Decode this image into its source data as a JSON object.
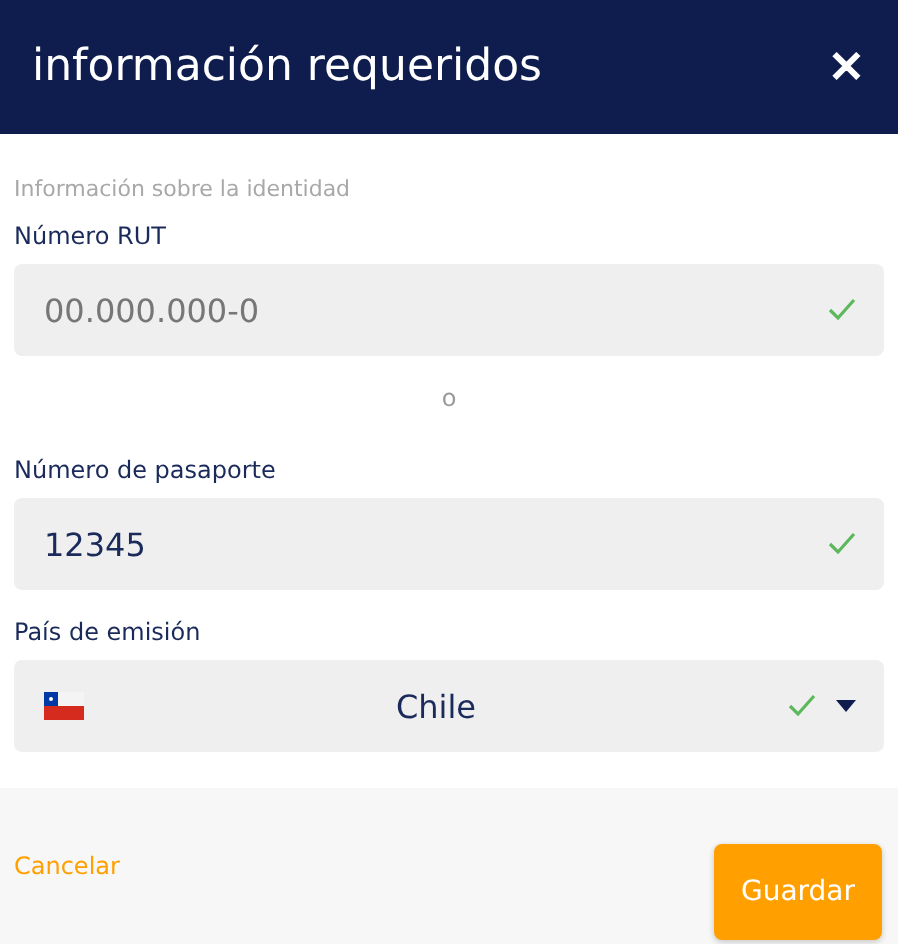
{
  "header": {
    "title": "información requeridos",
    "close": "✕"
  },
  "section_label": "Información sobre la identidad",
  "fields": [
    {
      "kind": "text",
      "label": "Número RUT",
      "placeholder": "00.000.000-0",
      "valid": true
    },
    {
      "kind": "separator",
      "text": "o"
    },
    {
      "kind": "text",
      "label": "Número de pasaporte",
      "value": "12345",
      "valid": true
    },
    {
      "kind": "select",
      "label": "País de emisión",
      "value": "Chile",
      "valid": true
    }
  ],
  "footer": {
    "cancel": "Cancelar",
    "save": "Guardar"
  }
}
